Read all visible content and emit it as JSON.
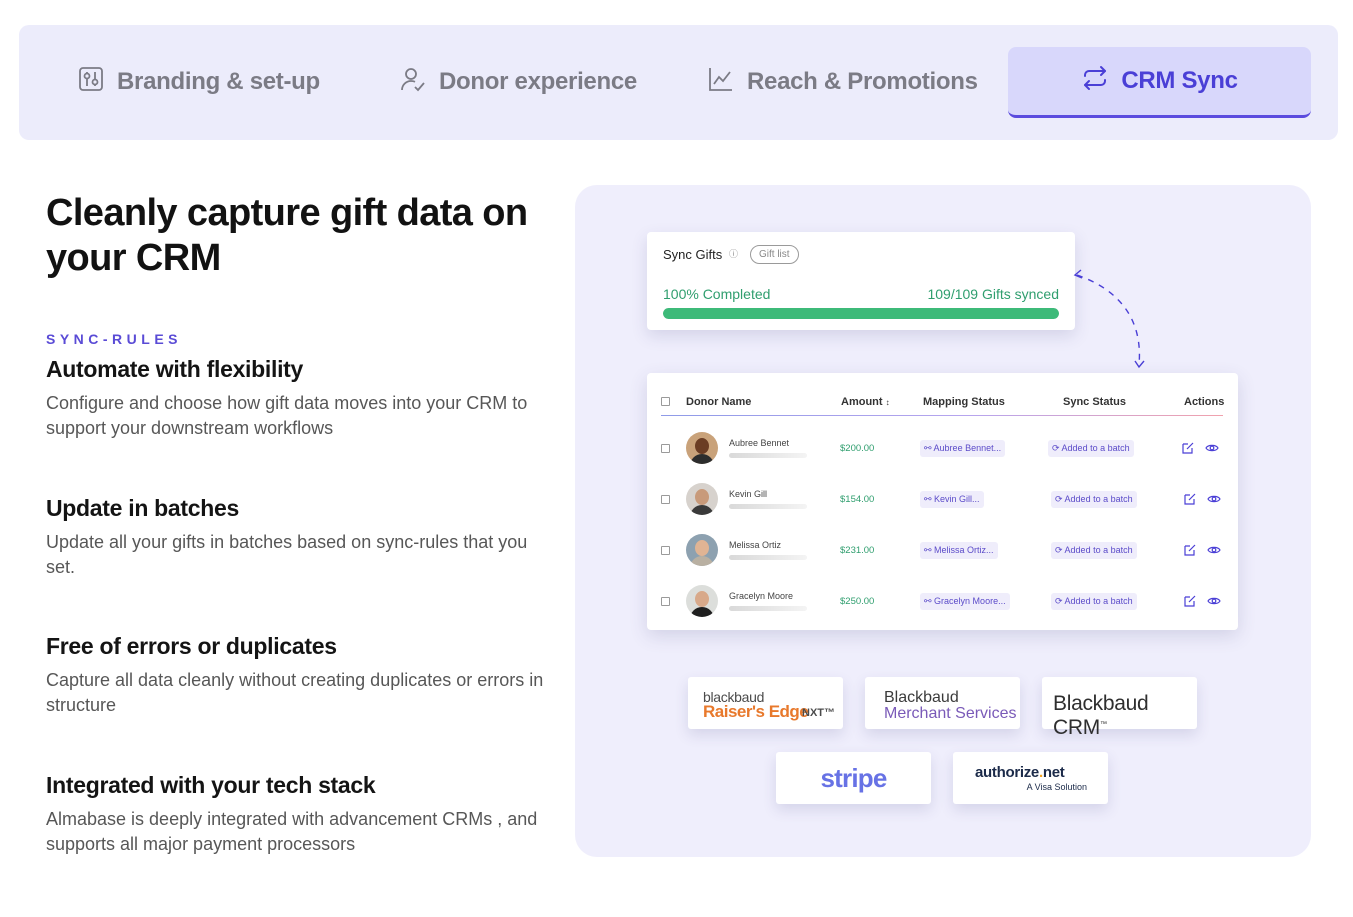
{
  "tabs": [
    {
      "label": "Branding & set-up",
      "icon": "sliders-icon",
      "active": false
    },
    {
      "label": "Donor experience",
      "icon": "user-check-icon",
      "active": false
    },
    {
      "label": "Reach & Promotions",
      "icon": "line-chart-icon",
      "active": false
    },
    {
      "label": "CRM Sync",
      "icon": "sync-arrows-icon",
      "active": true
    }
  ],
  "headline": "Cleanly capture  gift data on your CRM",
  "eyebrow": "SYNC-RULES",
  "features": [
    {
      "title": "Automate with flexibility",
      "body": "Configure and choose how gift data moves into your CRM to support your downstream workflows"
    },
    {
      "title": "Update in batches",
      "body": "Update all your gifts in batches based on sync-rules that you set."
    },
    {
      "title": "Free of errors or duplicates",
      "body": "Capture all data cleanly without creating duplicates or errors in structure"
    },
    {
      "title": "Integrated with your tech stack",
      "body": "Almabase is deeply integrated with advancement CRMs , and supports all major payment processors"
    }
  ],
  "sync_card": {
    "title": "Sync Gifts",
    "info_glyph": "ⓘ",
    "pill": "Gift list",
    "completed": "100% Completed",
    "synced": "109/109 Gifts synced",
    "progress": 1.0,
    "progress_color": "#3dba79"
  },
  "table": {
    "headers": {
      "name": "Donor Name",
      "amount": "Amount",
      "amount_sort": "↕",
      "mapping": "Mapping Status",
      "sync": "Sync Status",
      "actions": "Actions"
    },
    "rows": [
      {
        "name": "Aubree Bennet",
        "amount": "$200.00",
        "mapping": "Aubree Bennet...",
        "sync": "Added to a batch"
      },
      {
        "name": "Kevin Gill",
        "amount": "$154.00",
        "mapping": "Kevin Gill...",
        "sync": "Added to a batch"
      },
      {
        "name": "Melissa Ortiz",
        "amount": "$231.00",
        "mapping": "Melissa Ortiz...",
        "sync": "Added to a batch"
      },
      {
        "name": "Gracelyn Moore",
        "amount": "$250.00",
        "mapping": "Gracelyn Moore...",
        "sync": "Added to a batch"
      }
    ]
  },
  "integrations": {
    "raisers_edge": {
      "line1": "blackbaud",
      "line2": "Raiser's Edge",
      "suffix": "NXT™"
    },
    "merchant_services": {
      "line1": "Blackbaud",
      "line2": "Merchant Services"
    },
    "blackbaud_crm": {
      "label": "Blackbaud CRM",
      "mark": "™"
    },
    "stripe": {
      "label": "stripe"
    },
    "authorize_net": {
      "label_main": "authorize",
      "label_dot": ".",
      "label_end": "net",
      "sub": "A Visa Solution"
    }
  },
  "colors": {
    "accent": "#5b4bde",
    "tab_bar_bg": "#ececfb",
    "panel_bg": "#efeefc",
    "success": "#2f9e6e"
  }
}
